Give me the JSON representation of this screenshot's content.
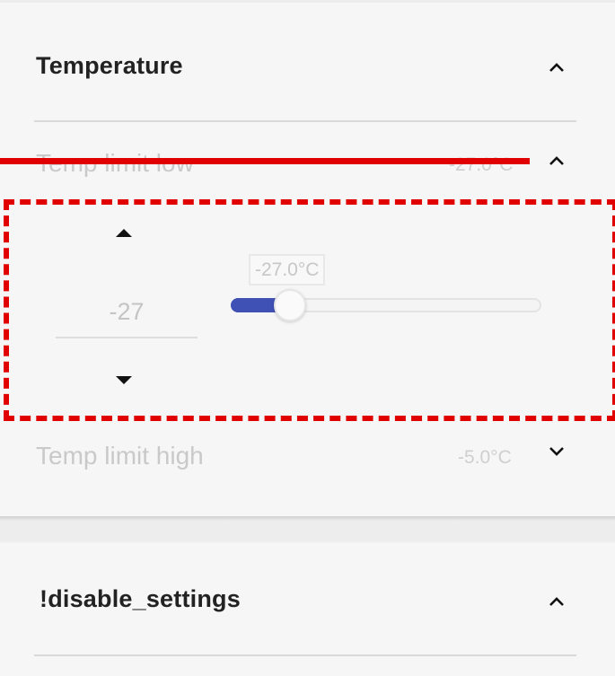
{
  "temperature_section": {
    "title": "Temperature",
    "chevron_icon": "chevron-up-icon",
    "rows": [
      {
        "label": "Temp limit low",
        "value": "-27.0°C",
        "chevron_icon": "chevron-up-icon",
        "expanded": true,
        "editor": {
          "spinner_value": "-27",
          "spin_up_icon": "triangle-up-icon",
          "spin_down_icon": "triangle-down-icon",
          "slider_tooltip": "-27.0°C",
          "slider_level_fraction": 0.19
        }
      },
      {
        "label": "Temp limit high",
        "value": "-5.0°C",
        "chevron_icon": "chevron-down-icon",
        "expanded": false
      }
    ]
  },
  "disable_section": {
    "title": "!disable_settings",
    "chevron_icon": "chevron-up-icon"
  },
  "colors": {
    "accent": "#3f51b5",
    "annotation_red": "#e00000",
    "background": "#f6f6f6"
  }
}
